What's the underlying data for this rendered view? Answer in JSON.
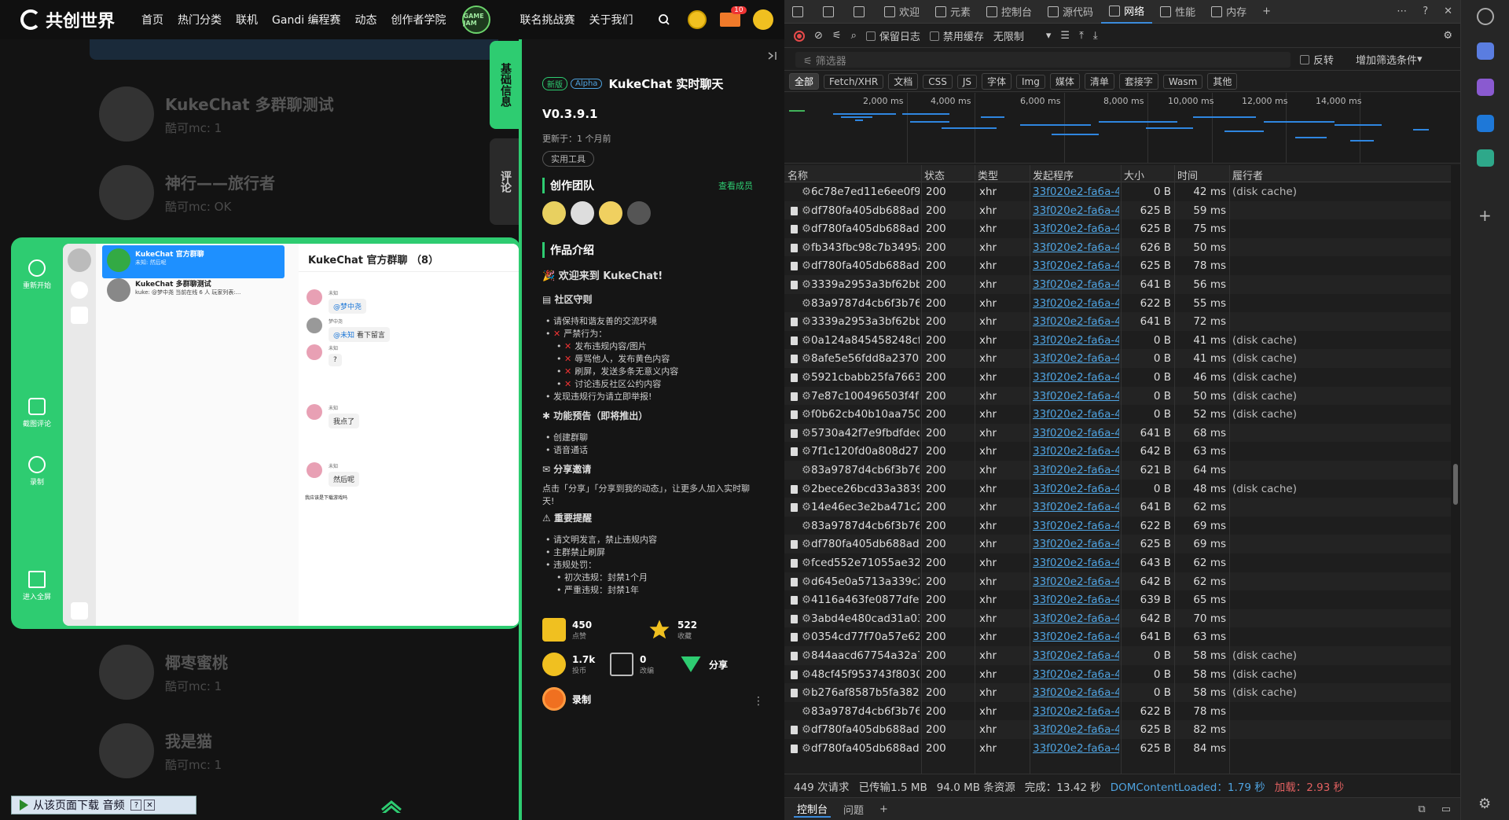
{
  "site": {
    "logo": "共创世界",
    "nav": [
      {
        "label": "首页",
        "badge": ""
      },
      {
        "label": "热门分类",
        "badge": "New"
      },
      {
        "label": "联机",
        "badge": ""
      },
      {
        "label": "Gandi 编程赛",
        "badge": ""
      },
      {
        "label": "动态",
        "badge": "99+"
      },
      {
        "label": "创作者学院",
        "badge": "New"
      }
    ],
    "jam_label": "GAME JAM",
    "nav_right": [
      "联名挑战赛",
      "关于我们"
    ],
    "mail_badge": "10"
  },
  "bg_list": [
    {
      "title": "KukeChat 多群聊测试",
      "sub": "酷可mc: 1"
    },
    {
      "title": "神行——旅行者",
      "sub": "酷可mc: OK"
    },
    {
      "title": "椰枣蜜桃",
      "sub": "酷可mc: 1"
    },
    {
      "title": "我是猫",
      "sub": "酷可mc: 1"
    }
  ],
  "chat": {
    "side_buttons": [
      "重新开始",
      "截图评论",
      "录制",
      "进入全屏"
    ],
    "conversations": [
      {
        "title": "KukeChat 官方群聊",
        "sub": "未知: 然后呢",
        "active": true
      },
      {
        "title": "KukeChat 多群聊测试",
        "sub": "kuke: @梦中尧 当前在线 6 人 玩家列表:...",
        "active": false
      }
    ],
    "header": "KukeChat 官方群聊 （8）",
    "messages": [
      {
        "name": "未知",
        "text": "",
        "at": "@梦中尧"
      },
      {
        "name": "梦中尧",
        "text": " 看下留言",
        "at": "@未知"
      },
      {
        "name": "未知",
        "text": "?",
        "at": ""
      },
      {
        "name": "未知",
        "text": "我点了",
        "at": ""
      },
      {
        "name": "未知",
        "text": "然后呢",
        "at": ""
      }
    ],
    "input_text": "我应该是下载游戏吗"
  },
  "info": {
    "tabs": [
      "基础信息",
      "评论"
    ],
    "tag_new": "新版",
    "tag_alpha": "Alpha",
    "title": "KukeChat 实时聊天",
    "version": "V0.3.9.1",
    "updated": "更新于：1 个月前",
    "category": "实用工具",
    "team_title": "创作团队",
    "team_more": "查看成员",
    "intro_title": "作品介绍",
    "welcome": "欢迎来到 KukeChat!",
    "rules_title": "社区守则",
    "rules": [
      "请保持和谐友善的交流环境",
      "严禁行为："
    ],
    "forbidden": [
      "发布违规内容/图片",
      "辱骂他人，发布黄色内容",
      "刷屏，发送多条无意义内容",
      "讨论违反社区公约内容"
    ],
    "report": "发现违规行为请立即举报!",
    "preview_title": "功能预告（即将推出）",
    "preview": [
      "创建群聊",
      "语音通话"
    ],
    "share_title": "分享邀请",
    "share_text": "点击「分享」「分享到我的动态」，让更多人加入实时聊天!",
    "notice_title": "重要提醒",
    "notice": [
      "请文明发言，禁止违规内容",
      "主群禁止刷屏",
      "违规处罚："
    ],
    "penalties": [
      "初次违规：封禁1个月",
      "严重违规：封禁1年"
    ],
    "stats": [
      {
        "num": "450",
        "label": "点赞"
      },
      {
        "num": "522",
        "label": "收藏"
      },
      {
        "num": "1.7k",
        "label": "投币"
      },
      {
        "num": "0",
        "label": "改编"
      },
      {
        "num": "分享",
        "label": ""
      },
      {
        "num": "录制",
        "label": ""
      }
    ]
  },
  "devtools": {
    "tabs": [
      "欢迎",
      "元素",
      "控制台",
      "源代码",
      "网络",
      "性能",
      "内存"
    ],
    "active_tab": "网络",
    "toolbar": {
      "preserve_log": "保留日志",
      "disable_cache": "禁用缓存",
      "throttle": "无限制"
    },
    "filter_placeholder": "筛选器",
    "invert": "反转",
    "more_filters": "增加筛选条件",
    "types": [
      "全部",
      "Fetch/XHR",
      "文档",
      "CSS",
      "JS",
      "字体",
      "Img",
      "媒体",
      "清单",
      "套接字",
      "Wasm",
      "其他"
    ],
    "ticks": [
      "2,000 ms",
      "4,000 ms",
      "6,000 ms",
      "8,000 ms",
      "10,000 ms",
      "12,000 ms",
      "14,000 ms"
    ],
    "columns": [
      "名称",
      "状态",
      "类型",
      "发起程序",
      "大小",
      "时间",
      "履行者"
    ],
    "rows": [
      {
        "icon": "gear",
        "name": "6c78e7ed11e6ee0f9395...",
        "status": "200",
        "type": "xhr",
        "init": "33f020e2-fa6a-40e5-",
        "size": "0 B",
        "time": "42 ms",
        "by": "(disk cache)"
      },
      {
        "icon": "doc",
        "name": "df780fa405db688ad95b...",
        "status": "200",
        "type": "xhr",
        "init": "33f020e2-fa6a-40e5-",
        "size": "625 B",
        "time": "59 ms",
        "by": ""
      },
      {
        "icon": "doc",
        "name": "df780fa405db688ad95b...",
        "status": "200",
        "type": "xhr",
        "init": "33f020e2-fa6a-40e5-",
        "size": "625 B",
        "time": "75 ms",
        "by": ""
      },
      {
        "icon": "doc",
        "name": "fb343fbc98c7b3495aa9...",
        "status": "200",
        "type": "xhr",
        "init": "33f020e2-fa6a-40e5-",
        "size": "626 B",
        "time": "50 ms",
        "by": ""
      },
      {
        "icon": "doc",
        "name": "df780fa405db688ad95b...",
        "status": "200",
        "type": "xhr",
        "init": "33f020e2-fa6a-40e5-",
        "size": "625 B",
        "time": "78 ms",
        "by": ""
      },
      {
        "icon": "doc",
        "name": "3339a2953a3bf62bb80e...",
        "status": "200",
        "type": "xhr",
        "init": "33f020e2-fa6a-40e5-",
        "size": "641 B",
        "time": "56 ms",
        "by": ""
      },
      {
        "icon": "gear",
        "name": "83a9787d4cb6f3b7632b...",
        "status": "200",
        "type": "xhr",
        "init": "33f020e2-fa6a-40e5-",
        "size": "622 B",
        "time": "55 ms",
        "by": ""
      },
      {
        "icon": "doc",
        "name": "3339a2953a3bf62bb80e...",
        "status": "200",
        "type": "xhr",
        "init": "33f020e2-fa6a-40e5-",
        "size": "641 B",
        "time": "72 ms",
        "by": ""
      },
      {
        "icon": "doc",
        "name": "0a124a845458248cf0b8...",
        "status": "200",
        "type": "xhr",
        "init": "33f020e2-fa6a-40e5-",
        "size": "0 B",
        "time": "41 ms",
        "by": "(disk cache)"
      },
      {
        "icon": "doc",
        "name": "8afe5e56fdd8a2370bb1...",
        "status": "200",
        "type": "xhr",
        "init": "33f020e2-fa6a-40e5-",
        "size": "0 B",
        "time": "41 ms",
        "by": "(disk cache)"
      },
      {
        "icon": "doc",
        "name": "5921cbabb25fa766398a...",
        "status": "200",
        "type": "xhr",
        "init": "33f020e2-fa6a-40e5-",
        "size": "0 B",
        "time": "46 ms",
        "by": "(disk cache)"
      },
      {
        "icon": "doc",
        "name": "7e87c100496503f4f149...",
        "status": "200",
        "type": "xhr",
        "init": "33f020e2-fa6a-40e5-",
        "size": "0 B",
        "time": "50 ms",
        "by": "(disk cache)"
      },
      {
        "icon": "doc",
        "name": "f0b62cb40b10aa750bf5...",
        "status": "200",
        "type": "xhr",
        "init": "33f020e2-fa6a-40e5-",
        "size": "0 B",
        "time": "52 ms",
        "by": "(disk cache)"
      },
      {
        "icon": "doc",
        "name": "5730a42f7e9fbdfdec67f...",
        "status": "200",
        "type": "xhr",
        "init": "33f020e2-fa6a-40e5-",
        "size": "641 B",
        "time": "68 ms",
        "by": ""
      },
      {
        "icon": "doc",
        "name": "7f1c120fd0a808d273c1...",
        "status": "200",
        "type": "xhr",
        "init": "33f020e2-fa6a-40e5-",
        "size": "642 B",
        "time": "63 ms",
        "by": ""
      },
      {
        "icon": "gear",
        "name": "83a9787d4cb6f3b7632b...",
        "status": "200",
        "type": "xhr",
        "init": "33f020e2-fa6a-40e5-",
        "size": "621 B",
        "time": "64 ms",
        "by": ""
      },
      {
        "icon": "doc",
        "name": "2bece26bcd33a3839fd7...",
        "status": "200",
        "type": "xhr",
        "init": "33f020e2-fa6a-40e5-",
        "size": "0 B",
        "time": "48 ms",
        "by": "(disk cache)"
      },
      {
        "icon": "doc",
        "name": "14e46ec3e2ba471c2adf...",
        "status": "200",
        "type": "xhr",
        "init": "33f020e2-fa6a-40e5-",
        "size": "641 B",
        "time": "62 ms",
        "by": ""
      },
      {
        "icon": "gear",
        "name": "83a9787d4cb6f3b7632b...",
        "status": "200",
        "type": "xhr",
        "init": "33f020e2-fa6a-40e5-",
        "size": "622 B",
        "time": "69 ms",
        "by": ""
      },
      {
        "icon": "doc",
        "name": "df780fa405db688ad95b...",
        "status": "200",
        "type": "xhr",
        "init": "33f020e2-fa6a-40e5-",
        "size": "625 B",
        "time": "69 ms",
        "by": ""
      },
      {
        "icon": "doc",
        "name": "fced552e71055ae324d4...",
        "status": "200",
        "type": "xhr",
        "init": "33f020e2-fa6a-40e5-",
        "size": "643 B",
        "time": "62 ms",
        "by": ""
      },
      {
        "icon": "doc",
        "name": "d645e0a5713a339c2ce0...",
        "status": "200",
        "type": "xhr",
        "init": "33f020e2-fa6a-40e5-",
        "size": "642 B",
        "time": "62 ms",
        "by": ""
      },
      {
        "icon": "doc",
        "name": "4116a463fe0877dfe1d3...",
        "status": "200",
        "type": "xhr",
        "init": "33f020e2-fa6a-40e5-",
        "size": "639 B",
        "time": "65 ms",
        "by": ""
      },
      {
        "icon": "doc",
        "name": "3abd4e480cad31a036c7...",
        "status": "200",
        "type": "xhr",
        "init": "33f020e2-fa6a-40e5-",
        "size": "642 B",
        "time": "70 ms",
        "by": ""
      },
      {
        "icon": "doc",
        "name": "0354cd77f70a57e62b4b...",
        "status": "200",
        "type": "xhr",
        "init": "33f020e2-fa6a-40e5-",
        "size": "641 B",
        "time": "63 ms",
        "by": ""
      },
      {
        "icon": "doc",
        "name": "844aacd67754a32a7ceb...",
        "status": "200",
        "type": "xhr",
        "init": "33f020e2-fa6a-40e5-",
        "size": "0 B",
        "time": "58 ms",
        "by": "(disk cache)"
      },
      {
        "icon": "doc",
        "name": "48cf45f953743f8030889...",
        "status": "200",
        "type": "xhr",
        "init": "33f020e2-fa6a-40e5-",
        "size": "0 B",
        "time": "58 ms",
        "by": "(disk cache)"
      },
      {
        "icon": "doc",
        "name": "b276af8587b5fa382d21...",
        "status": "200",
        "type": "xhr",
        "init": "33f020e2-fa6a-40e5-",
        "size": "0 B",
        "time": "58 ms",
        "by": "(disk cache)"
      },
      {
        "icon": "gear",
        "name": "83a9787d4cb6f3b7632b...",
        "status": "200",
        "type": "xhr",
        "init": "33f020e2-fa6a-40e5-",
        "size": "622 B",
        "time": "78 ms",
        "by": ""
      },
      {
        "icon": "doc",
        "name": "df780fa405db688ad95b...",
        "status": "200",
        "type": "xhr",
        "init": "33f020e2-fa6a-40e5-",
        "size": "625 B",
        "time": "82 ms",
        "by": ""
      },
      {
        "icon": "doc",
        "name": "df780fa405db688ad95b...",
        "status": "200",
        "type": "xhr",
        "init": "33f020e2-fa6a-40e5-",
        "size": "625 B",
        "time": "84 ms",
        "by": ""
      }
    ],
    "status": {
      "requests": "449 次请求",
      "transferred": "已传输1.5 MB",
      "resources": "94.0 MB 条资源",
      "finish": "完成：13.42 秒",
      "dcl": "DOMContentLoaded：1.79 秒",
      "load": "加载：2.93 秒"
    },
    "drawer": [
      "控制台",
      "问题"
    ]
  },
  "download_bar": "从该页面下载 音频",
  "colors": {
    "accent_green": "#2ecc71",
    "link_blue": "#4fa3e0",
    "devtools_bg": "#1e1e1e"
  }
}
